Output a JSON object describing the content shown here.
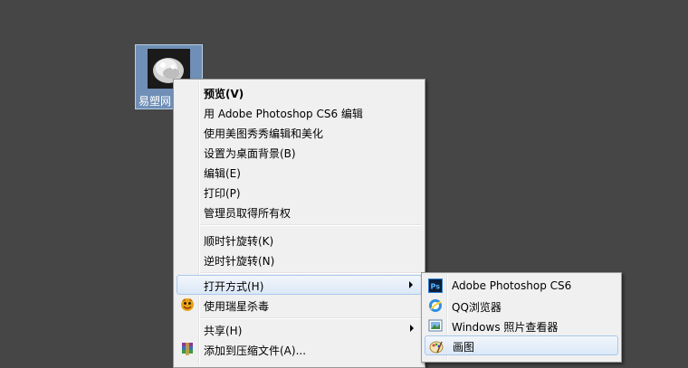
{
  "desktop": {
    "file_label": "易塑网"
  },
  "context_menu": {
    "items": [
      {
        "label": "预览(V)"
      },
      {
        "label": "用 Adobe Photoshop CS6 编辑"
      },
      {
        "label": "使用美图秀秀编辑和美化"
      },
      {
        "label": "设置为桌面背景(B)"
      },
      {
        "label": "编辑(E)"
      },
      {
        "label": "打印(P)"
      },
      {
        "label": "管理员取得所有权"
      },
      {
        "label": "顺时针旋转(K)"
      },
      {
        "label": "逆时针旋转(N)"
      },
      {
        "label": "打开方式(H)"
      },
      {
        "label": "使用瑞星杀毒"
      },
      {
        "label": "共享(H)"
      },
      {
        "label": "添加到压缩文件(A)..."
      }
    ]
  },
  "open_with_submenu": {
    "items": [
      {
        "label": "Adobe Photoshop CS6",
        "icon": "photoshop-icon"
      },
      {
        "label": "QQ浏览器",
        "icon": "qq-browser-icon"
      },
      {
        "label": "Windows 照片查看器",
        "icon": "photo-viewer-icon"
      },
      {
        "label": "画图",
        "icon": "paint-icon"
      }
    ]
  },
  "colors": {
    "desktop_bg": "#464646",
    "menu_bg": "#f0f0f0",
    "highlight_border": "#a8c8eb"
  }
}
